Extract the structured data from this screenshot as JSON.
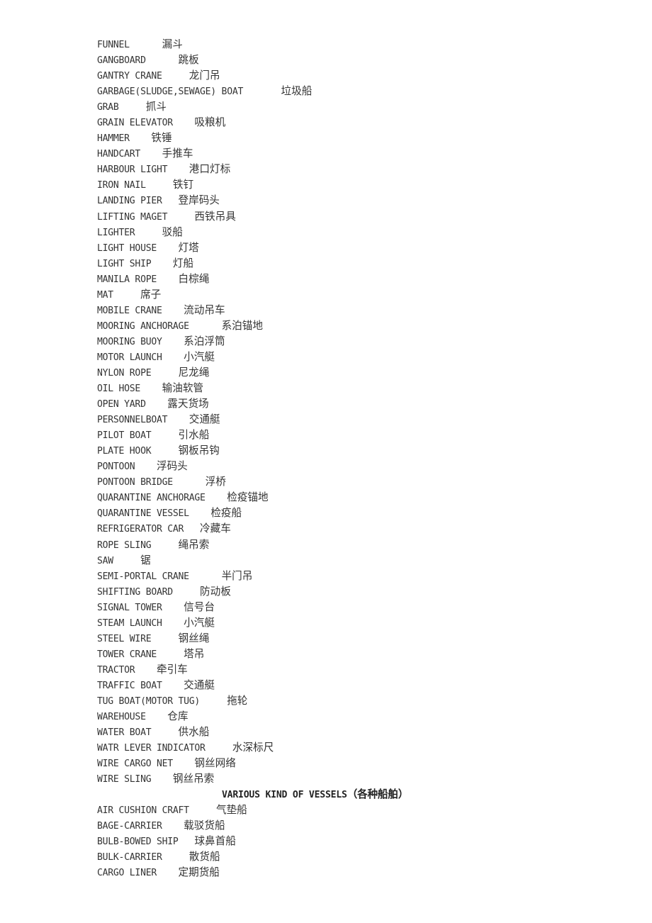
{
  "document": {
    "page_background": "#ffffff",
    "text_color": "#343434",
    "sections": [
      {
        "id": "port-equipment-continued",
        "heading": null,
        "entries": [
          {
            "term": "FUNNEL",
            "gap": 6,
            "cn": "漏斗"
          },
          {
            "term": "GANGBOARD",
            "gap": 6,
            "cn": "跳板"
          },
          {
            "term": "GANTRY CRANE",
            "gap": 5,
            "cn": "龙门吊"
          },
          {
            "term": "GARBAGE(SLUDGE,SEWAGE) BOAT",
            "gap": 7,
            "cn": "垃圾船"
          },
          {
            "term": "GRAB",
            "gap": 5,
            "cn": "抓斗"
          },
          {
            "term": "GRAIN ELEVATOR",
            "gap": 4,
            "cn": "吸粮机"
          },
          {
            "term": "HAMMER",
            "gap": 4,
            "cn": "铁锤"
          },
          {
            "term": "HANDCART",
            "gap": 4,
            "cn": "手推车"
          },
          {
            "term": "HARBOUR LIGHT",
            "gap": 4,
            "cn": "港口灯标"
          },
          {
            "term": "IRON NAIL",
            "gap": 5,
            "cn": "铁钉"
          },
          {
            "term": "LANDING PIER",
            "gap": 3,
            "cn": "登岸码头"
          },
          {
            "term": "LIFTING MAGET",
            "gap": 5,
            "cn": "西铁吊具"
          },
          {
            "term": "LIGHTER",
            "gap": 5,
            "cn": "驳船"
          },
          {
            "term": "LIGHT HOUSE",
            "gap": 4,
            "cn": "灯塔"
          },
          {
            "term": "LIGHT SHIP",
            "gap": 4,
            "cn": "灯船"
          },
          {
            "term": "MANILA ROPE",
            "gap": 4,
            "cn": "白棕绳"
          },
          {
            "term": "MAT",
            "gap": 5,
            "cn": "席子"
          },
          {
            "term": "MOBILE CRANE",
            "gap": 4,
            "cn": "流动吊车"
          },
          {
            "term": "MOORING ANCHORAGE",
            "gap": 6,
            "cn": "系泊锚地"
          },
          {
            "term": "MOORING BUOY",
            "gap": 4,
            "cn": "系泊浮筒"
          },
          {
            "term": "MOTOR LAUNCH",
            "gap": 4,
            "cn": "小汽艇"
          },
          {
            "term": "NYLON ROPE",
            "gap": 5,
            "cn": "尼龙绳"
          },
          {
            "term": "OIL HOSE",
            "gap": 4,
            "cn": "输油软管"
          },
          {
            "term": "OPEN YARD",
            "gap": 4,
            "cn": "露天货场"
          },
          {
            "term": "PERSONNELBOAT",
            "gap": 4,
            "cn": "交通艇"
          },
          {
            "term": "PILOT BOAT",
            "gap": 5,
            "cn": "引水船"
          },
          {
            "term": "PLATE HOOK",
            "gap": 5,
            "cn": "钢板吊钩"
          },
          {
            "term": "PONTOON",
            "gap": 4,
            "cn": "浮码头"
          },
          {
            "term": "PONTOON BRIDGE",
            "gap": 6,
            "cn": "浮桥"
          },
          {
            "term": "QUARANTINE ANCHORAGE",
            "gap": 4,
            "cn": "检疫锚地"
          },
          {
            "term": "QUARANTINE VESSEL",
            "gap": 4,
            "cn": "检疫船"
          },
          {
            "term": "REFRIGERATOR CAR",
            "gap": 3,
            "cn": "冷藏车"
          },
          {
            "term": "ROPE SLING",
            "gap": 5,
            "cn": "绳吊索"
          },
          {
            "term": "SAW",
            "gap": 5,
            "cn": "锯"
          },
          {
            "term": "SEMI-PORTAL CRANE",
            "gap": 6,
            "cn": "半门吊"
          },
          {
            "term": "SHIFTING BOARD",
            "gap": 5,
            "cn": "防动板"
          },
          {
            "term": "SIGNAL TOWER",
            "gap": 4,
            "cn": "信号台"
          },
          {
            "term": "STEAM LAUNCH",
            "gap": 4,
            "cn": "小汽艇"
          },
          {
            "term": "STEEL WIRE",
            "gap": 5,
            "cn": "钢丝绳"
          },
          {
            "term": "TOWER CRANE",
            "gap": 5,
            "cn": "塔吊"
          },
          {
            "term": "TRACTOR",
            "gap": 4,
            "cn": "牵引车"
          },
          {
            "term": "TRAFFIC BOAT",
            "gap": 4,
            "cn": "交通艇"
          },
          {
            "term": "TUG BOAT(MOTOR TUG)",
            "gap": 5,
            "cn": "拖轮"
          },
          {
            "term": "WAREHOUSE",
            "gap": 4,
            "cn": "仓库"
          },
          {
            "term": "WATER BOAT",
            "gap": 5,
            "cn": "供水船"
          },
          {
            "term": "WATR LEVER INDICATOR",
            "gap": 5,
            "cn": "水深标尺"
          },
          {
            "term": "WIRE CARGO NET",
            "gap": 4,
            "cn": "钢丝网络"
          },
          {
            "term": "WIRE SLING",
            "gap": 4,
            "cn": "钢丝吊索"
          }
        ]
      },
      {
        "id": "various-kind-of-vessels",
        "heading": {
          "english": "VARIOUS KIND OF VESSELS",
          "chinese": "（各种船舶）"
        },
        "entries": [
          {
            "term": "AIR CUSHION CRAFT",
            "gap": 5,
            "cn": "气垫船"
          },
          {
            "term": "BAGE-CARRIER",
            "gap": 4,
            "cn": "载驳货船"
          },
          {
            "term": "BULB-BOWED SHIP",
            "gap": 3,
            "cn": "球鼻首船"
          },
          {
            "term": "BULK-CARRIER",
            "gap": 5,
            "cn": "散货船"
          },
          {
            "term": "CARGO LINER",
            "gap": 4,
            "cn": "定期货船"
          }
        ]
      }
    ]
  }
}
